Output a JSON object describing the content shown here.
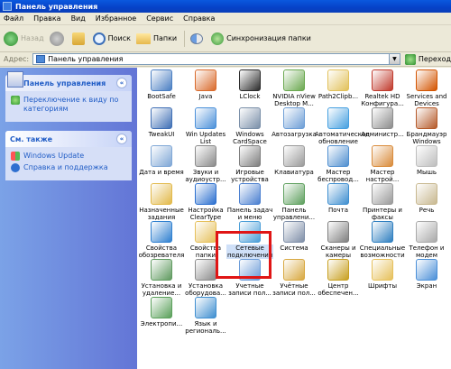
{
  "window": {
    "title": "Панель управления"
  },
  "menu": [
    "Файл",
    "Правка",
    "Вид",
    "Избранное",
    "Сервис",
    "Справка"
  ],
  "toolbar": {
    "back": "Назад",
    "search": "Поиск",
    "folders": "Папки",
    "sync": "Синхронизация папки"
  },
  "address": {
    "label": "Адрес:",
    "value": "Панель управления",
    "go": "Переход"
  },
  "left": {
    "panel1_title": "Панель управления",
    "switch_link": "Переключение к виду по категориям",
    "panel2_title": "См. также",
    "links": [
      "Windows Update",
      "Справка и поддержка"
    ]
  },
  "items": [
    {
      "label": "BootSafe",
      "color": "#4a7ec2"
    },
    {
      "label": "Java",
      "color": "#d96a2b"
    },
    {
      "label": "LClock",
      "color": "#2b2b2b"
    },
    {
      "label": "NVIDIA nView Desktop M...",
      "color": "#6aa84f"
    },
    {
      "label": "Path2Clipb...",
      "color": "#e2c15a"
    },
    {
      "label": "Realtek HD Конфигура...",
      "color": "#c0392b"
    },
    {
      "label": "Services and Devices",
      "color": "#d35400"
    },
    {
      "label": "TweakUI",
      "color": "#3f6fb5"
    },
    {
      "label": "Win Updates List",
      "color": "#4b90d9"
    },
    {
      "label": "Windows CardSpace",
      "color": "#7a8fa8"
    },
    {
      "label": "Автозагрузка",
      "color": "#6d9ed6"
    },
    {
      "label": "Автоматическое обновление",
      "color": "#46a0e0"
    },
    {
      "label": "Администр...",
      "color": "#8c8c8c"
    },
    {
      "label": "Брандмауэр Windows",
      "color": "#b55a2a"
    },
    {
      "label": "Дата и время",
      "color": "#7fa7d6"
    },
    {
      "label": "Звуки и аудиоустр...",
      "color": "#8a8a8a"
    },
    {
      "label": "Игровые устройства",
      "color": "#7d7d7d"
    },
    {
      "label": "Клавиатура",
      "color": "#9a9a9a"
    },
    {
      "label": "Мастер беспровод...",
      "color": "#4f8fd0"
    },
    {
      "label": "Мастер настрой...",
      "color": "#d98b3a"
    },
    {
      "label": "Мышь",
      "color": "#bdbdbd"
    },
    {
      "label": "Назначенные задания",
      "color": "#e2b94a"
    },
    {
      "label": "Настройка ClearType",
      "color": "#2b6fcf"
    },
    {
      "label": "Панель задач и меню \"Пуск\"",
      "color": "#4a7fd0"
    },
    {
      "label": "Панель управлени...",
      "color": "#5ea05e"
    },
    {
      "label": "Почта",
      "color": "#3f8fd0"
    },
    {
      "label": "Принтеры и факсы",
      "color": "#9a9a9a"
    },
    {
      "label": "Речь",
      "color": "#c8b890"
    },
    {
      "label": "Свойства обозревателя",
      "color": "#2f80d0"
    },
    {
      "label": "Свойства папки",
      "color": "#e6c05a"
    },
    {
      "label": "Сетевые подключения",
      "color": "#4a9ed8"
    },
    {
      "label": "Система",
      "color": "#7f8fa8"
    },
    {
      "label": "Сканеры и камеры",
      "color": "#7f7f7f"
    },
    {
      "label": "Специальные возможности",
      "color": "#2f7fc0"
    },
    {
      "label": "Телефон и модем",
      "color": "#a8a8a8"
    },
    {
      "label": "Установка и удаление...",
      "color": "#5f9a5f"
    },
    {
      "label": "Установка оборудова...",
      "color": "#8a8a8a"
    },
    {
      "label": "Учетные записи пол...",
      "color": "#6a9bd8"
    },
    {
      "label": "Учётные записи пол...",
      "color": "#d8a840"
    },
    {
      "label": "Центр обеспечен...",
      "color": "#c8a020"
    },
    {
      "label": "Шрифты",
      "color": "#e6c05a"
    },
    {
      "label": "Экран",
      "color": "#4a8fd8"
    },
    {
      "label": "Электропи...",
      "color": "#5aa05a"
    },
    {
      "label": "Язык и региональ...",
      "color": "#3f8fd0"
    }
  ],
  "selected_index": 30
}
